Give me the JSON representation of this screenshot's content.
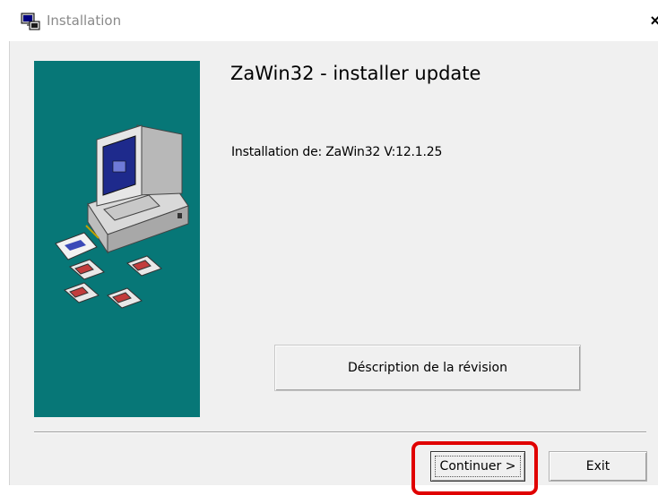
{
  "window": {
    "title": "Installation",
    "close_glyph": "×",
    "icon": "installer-icon"
  },
  "main": {
    "heading": "ZaWin32 - installer update",
    "install_text": "Installation de: ZaWin32  V:12.1.25",
    "description_button": "Déscription de la révision"
  },
  "footer": {
    "continue_button": "Continuer >",
    "exit_button": "Exit"
  },
  "side_panel": {
    "illustration": "computer-and-floppy-disks",
    "color": "#077777"
  },
  "colors": {
    "dialog_bg": "#f0f0f0",
    "highlight": "#e00000"
  }
}
